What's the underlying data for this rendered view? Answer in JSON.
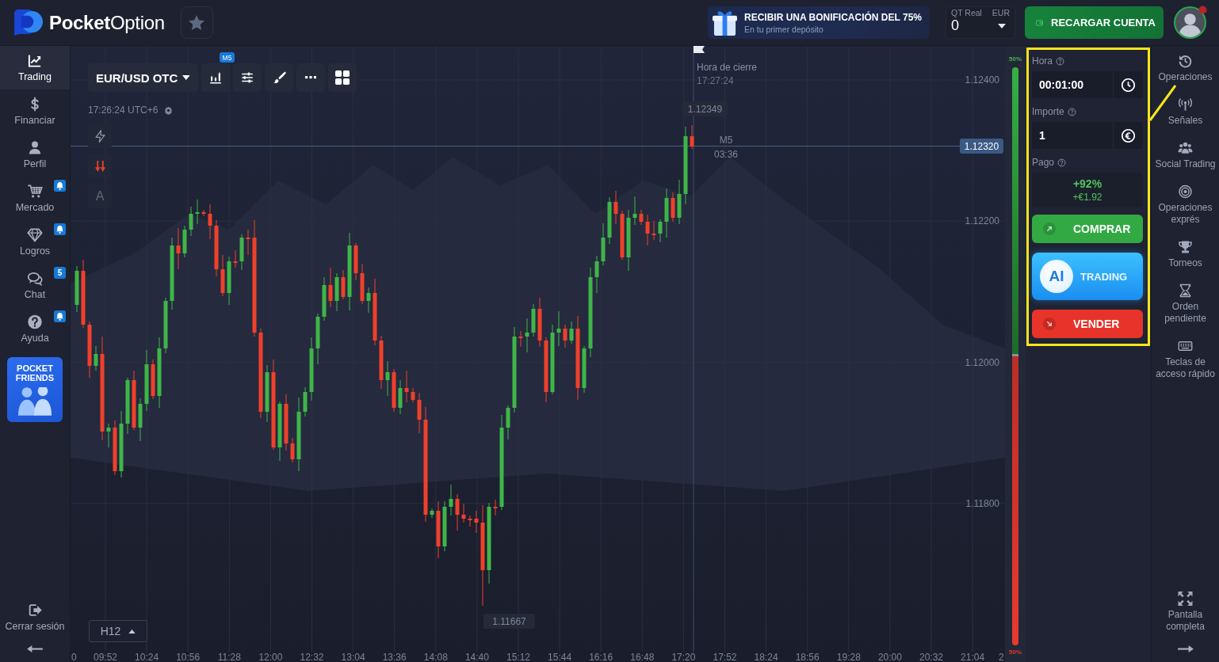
{
  "header": {
    "logo": "**Pocket**Option",
    "promo": {
      "title": "RECIBIR UNA BONIFICACIÓN DEL 75%",
      "subtitle": "En tu primer depósito"
    },
    "account": {
      "type": "QT Real",
      "currency": "EUR",
      "balance": "0"
    },
    "deposit_button": "RECARGAR CUENTA",
    "avatar": {
      "notification": true
    }
  },
  "left_sidebar": {
    "items": [
      {
        "label": "Trading",
        "selected": true,
        "alert": false
      },
      {
        "label": "Financiar",
        "selected": false,
        "alert": false
      },
      {
        "label": "Perfil",
        "selected": false,
        "alert": false
      },
      {
        "label": "Mercado",
        "selected": false,
        "alert": true
      },
      {
        "label": "Logros",
        "selected": false,
        "alert": true
      },
      {
        "label": "Chat",
        "selected": false,
        "alert": false,
        "badge": "5"
      },
      {
        "label": "Ayuda",
        "selected": false,
        "alert": true
      }
    ],
    "promo_card": "POCKET FRIENDS",
    "logout": "Cerrar sesión"
  },
  "chart": {
    "asset": "EUR/USD OTC",
    "timeframe_badge": "M5",
    "clock": "17:26:24 UTC+6",
    "text_tool": "A",
    "close_time": {
      "label": "Hora de cierre",
      "time": "17:27:24"
    },
    "high_label": "1.12349",
    "candle_timer": {
      "period": "M5",
      "countdown": "03:36"
    },
    "current_price": "1.12320",
    "low_label": "1.11667",
    "interval": "H12",
    "price_labels": [
      "1.12400",
      "1.12200",
      "1.12000",
      "1.11800"
    ],
    "time_labels": [
      "0",
      "09:52",
      "10:24",
      "10:56",
      "11:28",
      "12:00",
      "12:32",
      "13:04",
      "13:36",
      "14:08",
      "14:40",
      "15:12",
      "15:44",
      "16:16",
      "16:48",
      "17:20",
      "17:52",
      "18:24",
      "18:56",
      "19:28",
      "20:00",
      "20:32",
      "21:04",
      "2"
    ]
  },
  "sentiment": {
    "level": 0.5,
    "up_label": "50%",
    "down_label": "50%"
  },
  "trade_panel": {
    "time": {
      "label": "Hora",
      "value": "00:01:00"
    },
    "amount": {
      "label": "Importe",
      "value": "1"
    },
    "payout": {
      "label": "Pago",
      "percent": "+92%",
      "profit": "+€1.92"
    },
    "buy": "COMPRAR",
    "ai": {
      "badge": "AI",
      "label": "TRADING"
    },
    "sell": "VENDER"
  },
  "right_sidebar": {
    "items": [
      {
        "label": "Operaciones",
        "selected": false
      },
      {
        "label": "Señales",
        "selected": false
      },
      {
        "label": "Social Trading",
        "selected": false
      },
      {
        "label": "Operaciones exprés",
        "selected": false
      },
      {
        "label": "Torneos",
        "selected": false
      },
      {
        "label": "Orden pendiente",
        "selected": false
      },
      {
        "label": "Teclas de acceso rápido",
        "selected": false
      }
    ],
    "fullscreen": "Pantalla completa"
  }
}
